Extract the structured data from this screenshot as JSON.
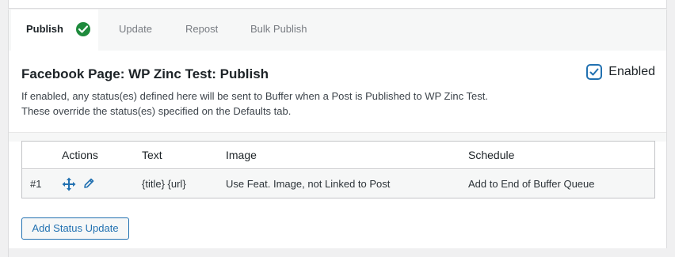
{
  "tabs": [
    {
      "label": "Publish",
      "active": true,
      "status_icon": "check-circle-icon"
    },
    {
      "label": "Update",
      "active": false
    },
    {
      "label": "Repost",
      "active": false
    },
    {
      "label": "Bulk Publish",
      "active": false
    }
  ],
  "section": {
    "title": "Facebook Page: WP Zinc Test: Publish",
    "description_line1": "If enabled, any status(es) defined here will be sent to Buffer when a Post is Published to WP Zinc Test.",
    "description_line2": "These override the status(es) specified on the Defaults tab.",
    "enabled_label": "Enabled",
    "enabled_checked": true
  },
  "table": {
    "headers": {
      "actions": "Actions",
      "text": "Text",
      "image": "Image",
      "schedule": "Schedule"
    },
    "rows": [
      {
        "num": "#1",
        "text": "{title} {url}",
        "image": "Use Feat. Image, not Linked to Post",
        "schedule": "Add to End of Buffer Queue",
        "action_icons": [
          "move-icon",
          "edit-icon"
        ]
      }
    ]
  },
  "add_button_label": "Add Status Update",
  "colors": {
    "accent": "#2271b1",
    "success": "#1e8a3c",
    "text": "#1d2327"
  }
}
